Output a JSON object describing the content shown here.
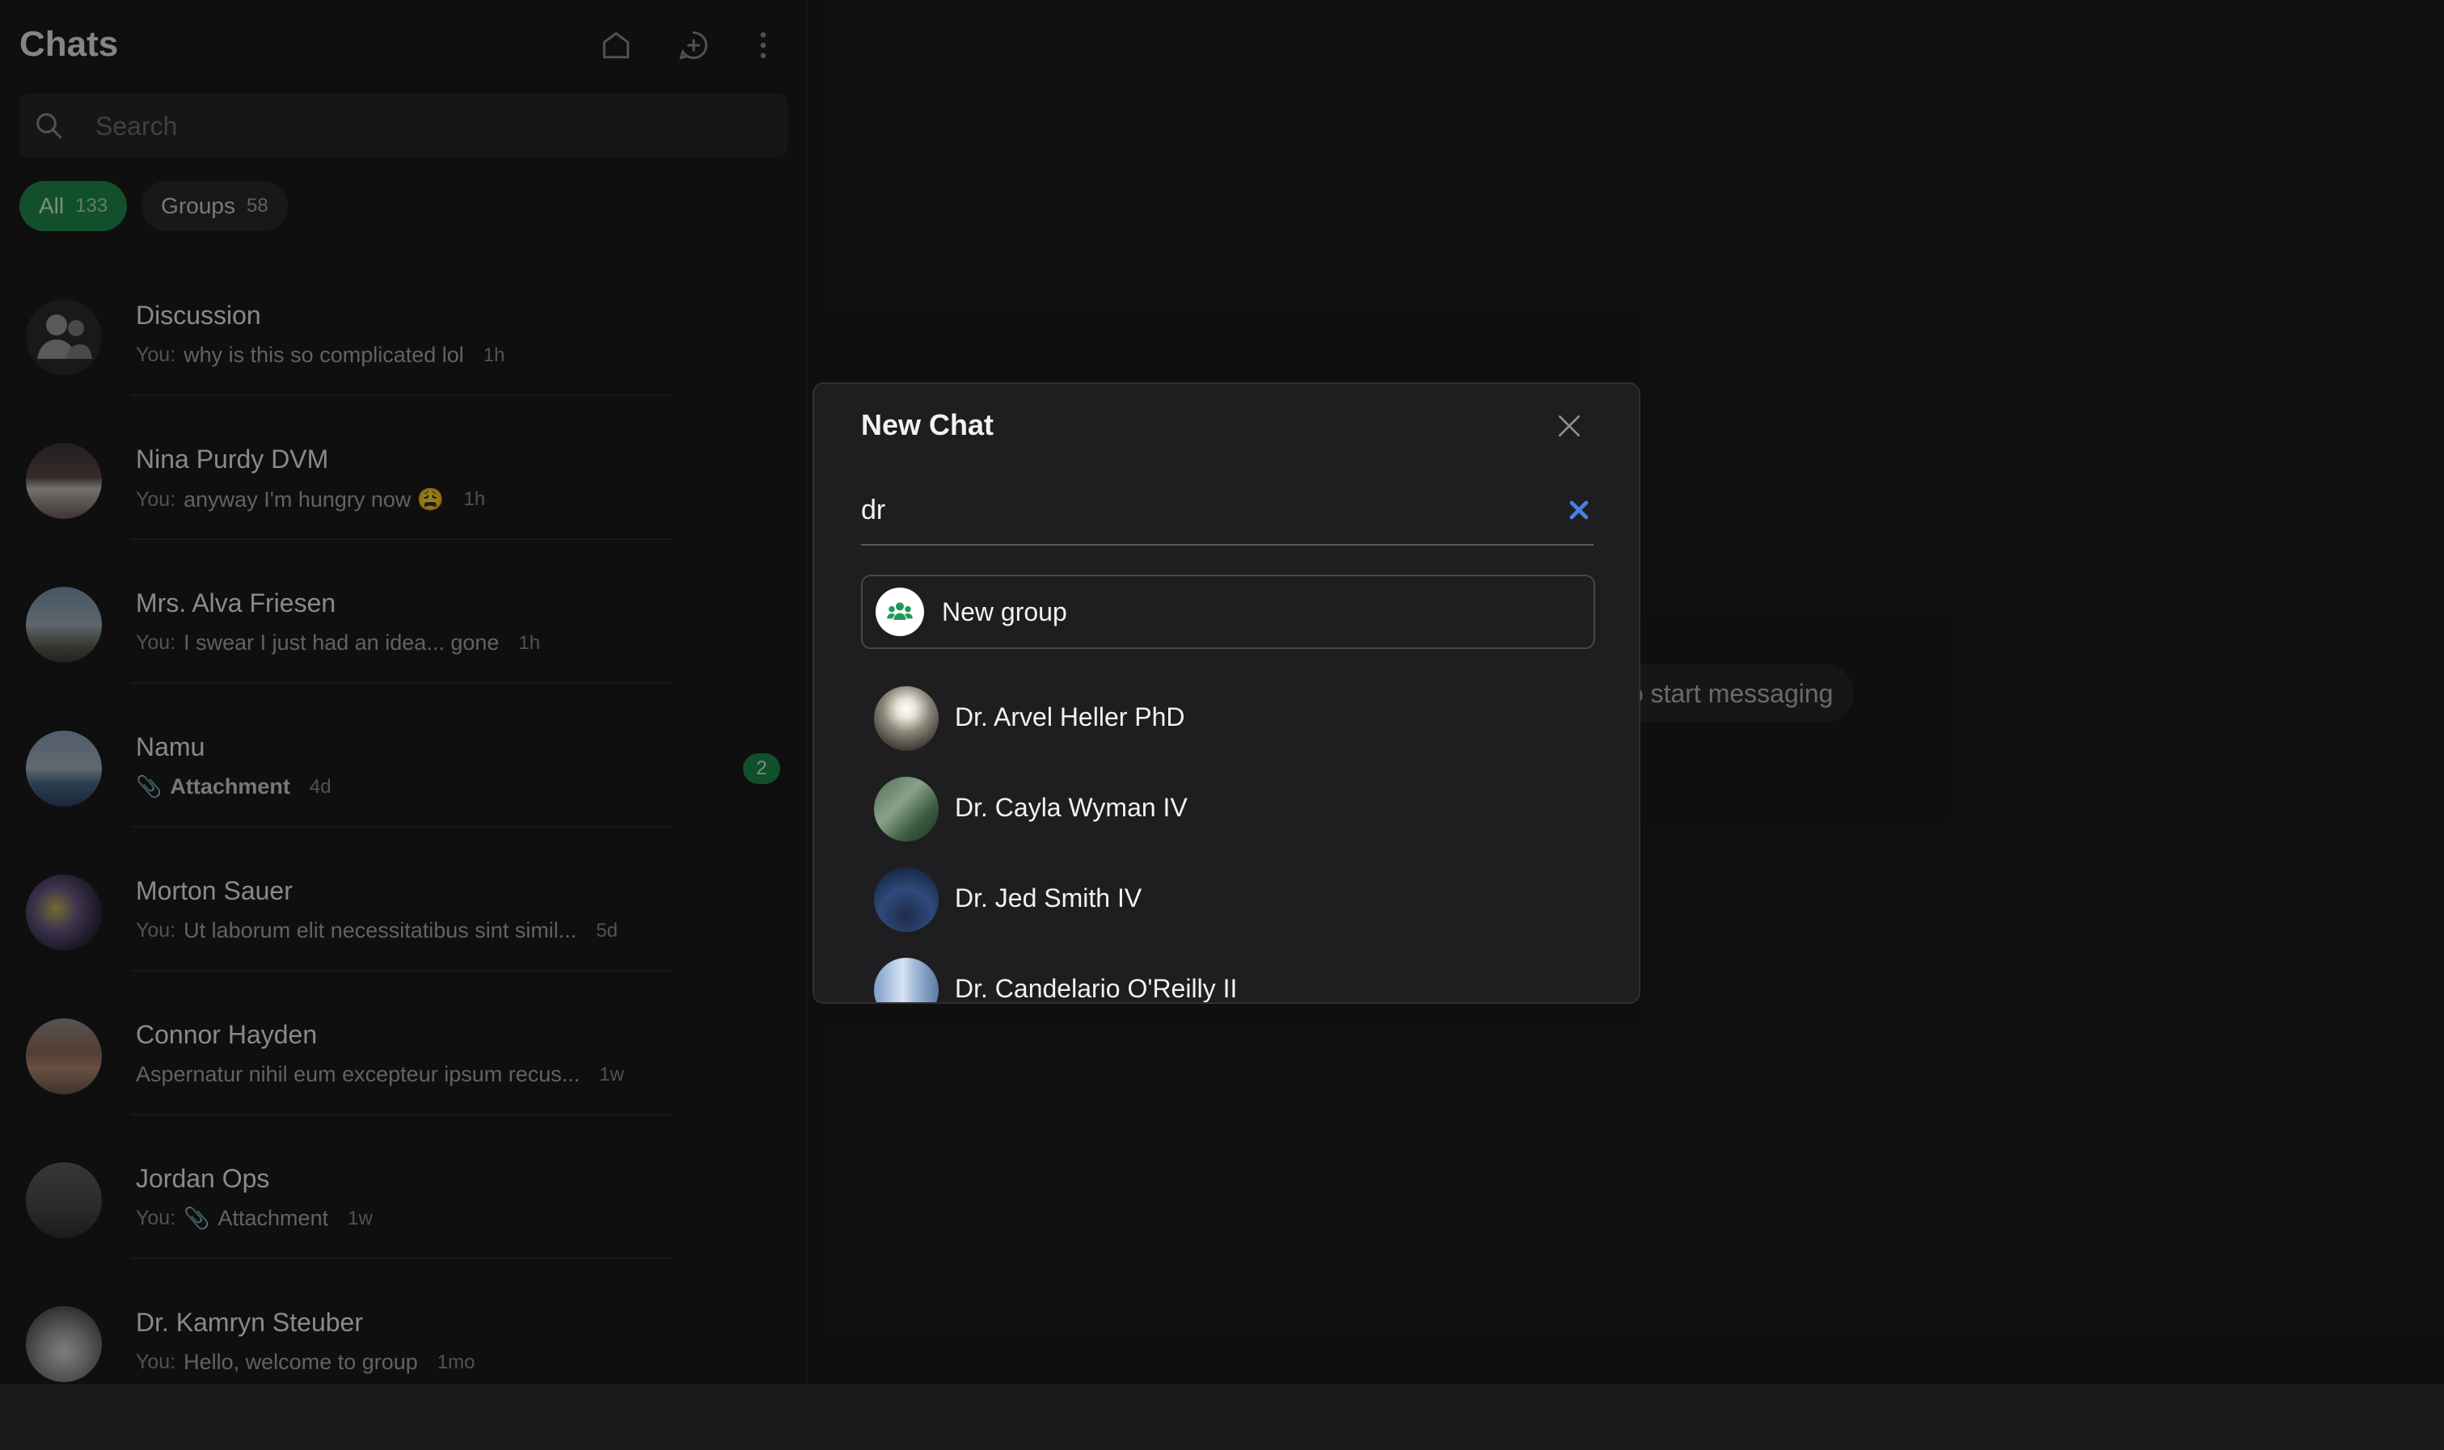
{
  "sidebar": {
    "title": "Chats",
    "search_placeholder": "Search",
    "filters": [
      {
        "label": "All",
        "count": "133"
      },
      {
        "label": "Groups",
        "count": "58"
      }
    ],
    "chats": [
      {
        "name": "Discussion",
        "you": "You:",
        "preview": "why is this so complicated lol",
        "time": "1h"
      },
      {
        "name": "Nina Purdy DVM",
        "you": "You:",
        "preview": "anyway I'm hungry now 😩",
        "time": "1h"
      },
      {
        "name": "Mrs. Alva Friesen",
        "you": "You:",
        "preview": "I swear I just had an idea... gone",
        "time": "1h"
      },
      {
        "name": "Namu",
        "you": "",
        "preview": "Attachment",
        "time": "4d",
        "unread": "2"
      },
      {
        "name": "Morton Sauer",
        "you": "You:",
        "preview": "Ut laborum elit necessitatibus sint simil...",
        "time": "5d"
      },
      {
        "name": "Connor Hayden",
        "you": "",
        "preview": "Aspernatur nihil eum excepteur ipsum recus...",
        "time": "1w"
      },
      {
        "name": "Jordan Ops",
        "you": "You:",
        "preview": "Attachment",
        "time": "1w"
      },
      {
        "name": "Dr. Kamryn Steuber",
        "you": "You:",
        "preview": "Hello, welcome to group",
        "time": "1mo"
      }
    ]
  },
  "main": {
    "hint": "to start messaging"
  },
  "modal": {
    "title": "New Chat",
    "query": "dr",
    "new_group_label": "New group",
    "contacts": [
      {
        "name": "Dr. Arvel Heller PhD"
      },
      {
        "name": "Dr. Cayla Wyman IV"
      },
      {
        "name": "Dr. Jed Smith IV"
      },
      {
        "name": "Dr. Candelario O'Reilly II"
      }
    ]
  },
  "colors": {
    "accent": "#1f8a4c",
    "clear_x": "#4a7fe0",
    "background": "#1b1b1d"
  }
}
